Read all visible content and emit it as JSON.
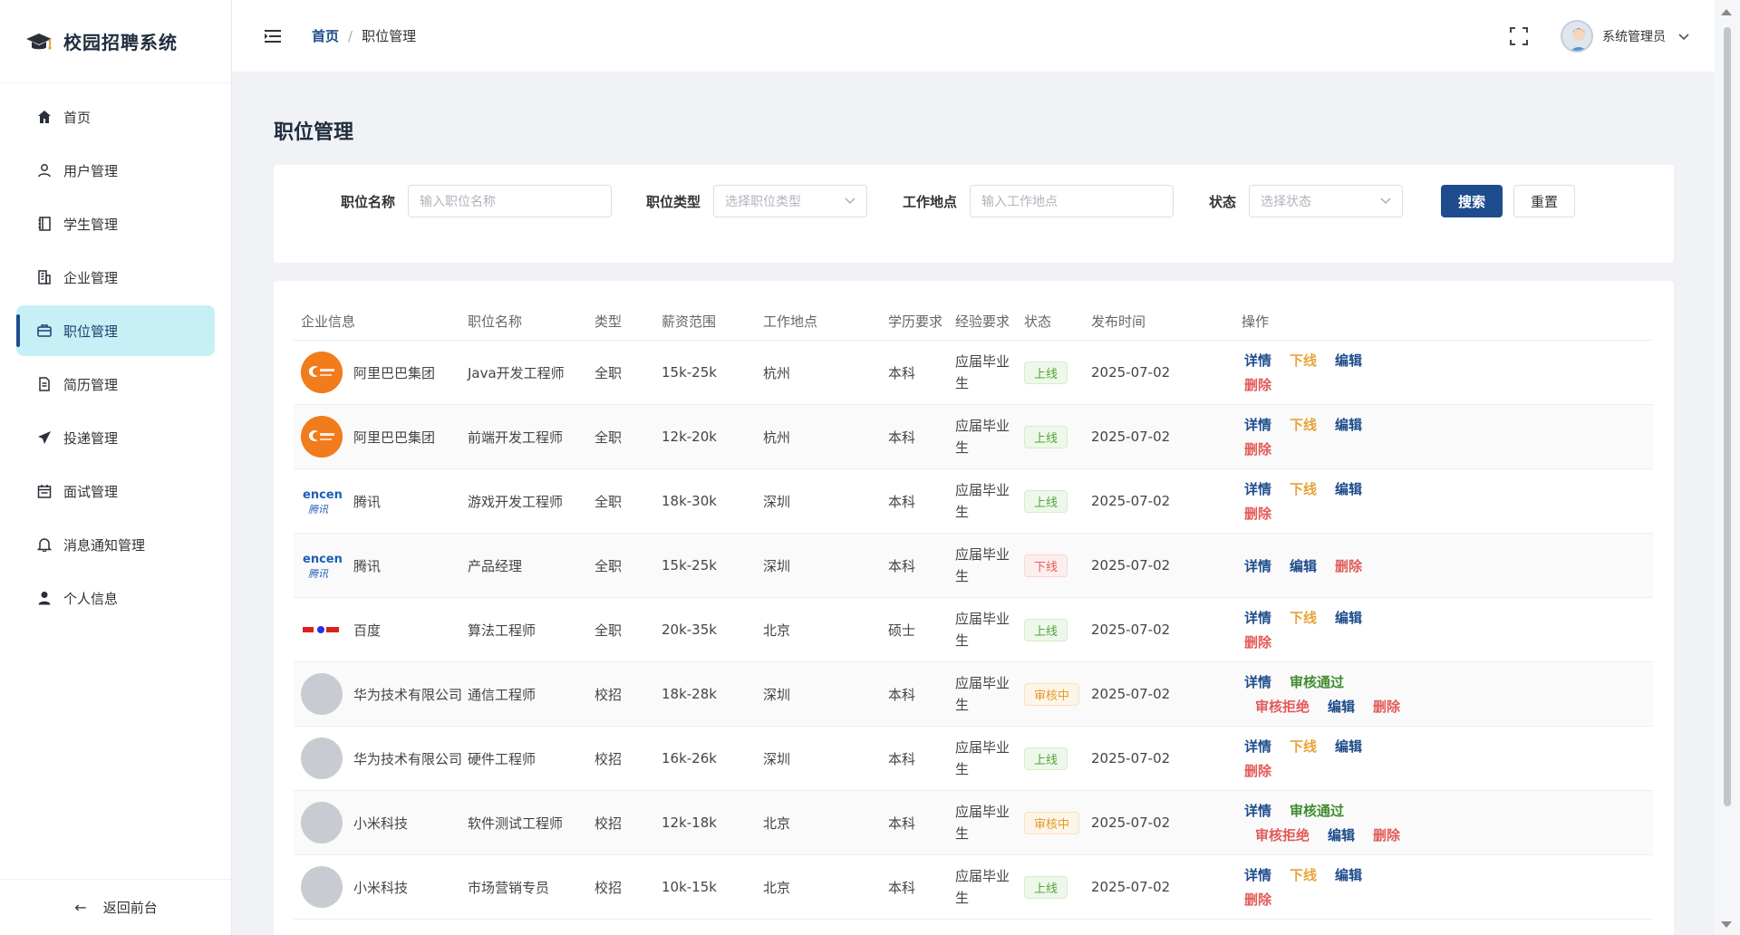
{
  "app": {
    "title": "校园招聘系统"
  },
  "sidebar": {
    "items": [
      {
        "label": "首页",
        "icon": "home-icon",
        "active": false
      },
      {
        "label": "用户管理",
        "icon": "user-icon",
        "active": false
      },
      {
        "label": "学生管理",
        "icon": "notebook-icon",
        "active": false
      },
      {
        "label": "企业管理",
        "icon": "building-icon",
        "active": false
      },
      {
        "label": "职位管理",
        "icon": "briefcase-icon",
        "active": true
      },
      {
        "label": "简历管理",
        "icon": "document-icon",
        "active": false
      },
      {
        "label": "投递管理",
        "icon": "send-icon",
        "active": false
      },
      {
        "label": "面试管理",
        "icon": "calendar-icon",
        "active": false
      },
      {
        "label": "消息通知管理",
        "icon": "bell-icon",
        "active": false
      },
      {
        "label": "个人信息",
        "icon": "person-icon",
        "active": false
      }
    ],
    "back_label": "返回前台"
  },
  "header": {
    "breadcrumb": {
      "home": "首页",
      "sep": "/",
      "current": "职位管理"
    },
    "user": "系统管理员"
  },
  "page": {
    "title": "职位管理"
  },
  "search": {
    "name_label": "职位名称",
    "name_placeholder": "输入职位名称",
    "type_label": "职位类型",
    "type_placeholder": "选择职位类型",
    "location_label": "工作地点",
    "location_placeholder": "输入工作地点",
    "status_label": "状态",
    "status_placeholder": "选择状态",
    "search_label": "搜索",
    "reset_label": "重置"
  },
  "table": {
    "columns": [
      "企业信息",
      "职位名称",
      "类型",
      "薪资范围",
      "工作地点",
      "学历要求",
      "经验要求",
      "状态",
      "发布时间",
      "操作"
    ],
    "op_labels": {
      "detail": "详情",
      "offline": "下线",
      "edit": "编辑",
      "delete": "删除",
      "approve": "审核通过",
      "reject": "审核拒绝"
    },
    "rows": [
      {
        "company": "阿里巴巴集团",
        "logo": "alibaba",
        "position": "Java开发工程师",
        "type": "全职",
        "salary": "15k-25k",
        "location": "杭州",
        "education": "本科",
        "experience": "应届毕业生",
        "status": "上线",
        "status_kind": "online",
        "date": "2025-07-02"
      },
      {
        "company": "阿里巴巴集团",
        "logo": "alibaba",
        "position": "前端开发工程师",
        "type": "全职",
        "salary": "12k-20k",
        "location": "杭州",
        "education": "本科",
        "experience": "应届毕业生",
        "status": "上线",
        "status_kind": "online",
        "date": "2025-07-02"
      },
      {
        "company": "腾讯",
        "logo": "tencent",
        "position": "游戏开发工程师",
        "type": "全职",
        "salary": "18k-30k",
        "location": "深圳",
        "education": "本科",
        "experience": "应届毕业生",
        "status": "上线",
        "status_kind": "online",
        "date": "2025-07-02"
      },
      {
        "company": "腾讯",
        "logo": "tencent",
        "position": "产品经理",
        "type": "全职",
        "salary": "15k-25k",
        "location": "深圳",
        "education": "本科",
        "experience": "应届毕业生",
        "status": "下线",
        "status_kind": "offline",
        "date": "2025-07-02"
      },
      {
        "company": "百度",
        "logo": "baidu",
        "position": "算法工程师",
        "type": "全职",
        "salary": "20k-35k",
        "location": "北京",
        "education": "硕士",
        "experience": "应届毕业生",
        "status": "上线",
        "status_kind": "online",
        "date": "2025-07-02"
      },
      {
        "company": "华为技术有限公司",
        "logo": "gray",
        "position": "通信工程师",
        "type": "校招",
        "salary": "18k-28k",
        "location": "深圳",
        "education": "本科",
        "experience": "应届毕业生",
        "status": "审核中",
        "status_kind": "review",
        "date": "2025-07-02"
      },
      {
        "company": "华为技术有限公司",
        "logo": "gray",
        "position": "硬件工程师",
        "type": "校招",
        "salary": "16k-26k",
        "location": "深圳",
        "education": "本科",
        "experience": "应届毕业生",
        "status": "上线",
        "status_kind": "online",
        "date": "2025-07-02"
      },
      {
        "company": "小米科技",
        "logo": "gray",
        "position": "软件测试工程师",
        "type": "校招",
        "salary": "12k-18k",
        "location": "北京",
        "education": "本科",
        "experience": "应届毕业生",
        "status": "审核中",
        "status_kind": "review",
        "date": "2025-07-02"
      },
      {
        "company": "小米科技",
        "logo": "gray",
        "position": "市场营销专员",
        "type": "校招",
        "salary": "10k-15k",
        "location": "北京",
        "education": "本科",
        "experience": "应届毕业生",
        "status": "上线",
        "status_kind": "online",
        "date": "2025-07-02"
      }
    ]
  },
  "colors": {
    "primary": "#1e4c8c",
    "active_bg": "#c6eff6",
    "online": "#52a33a",
    "offline": "#e65a5a",
    "review": "#e39a2a"
  }
}
